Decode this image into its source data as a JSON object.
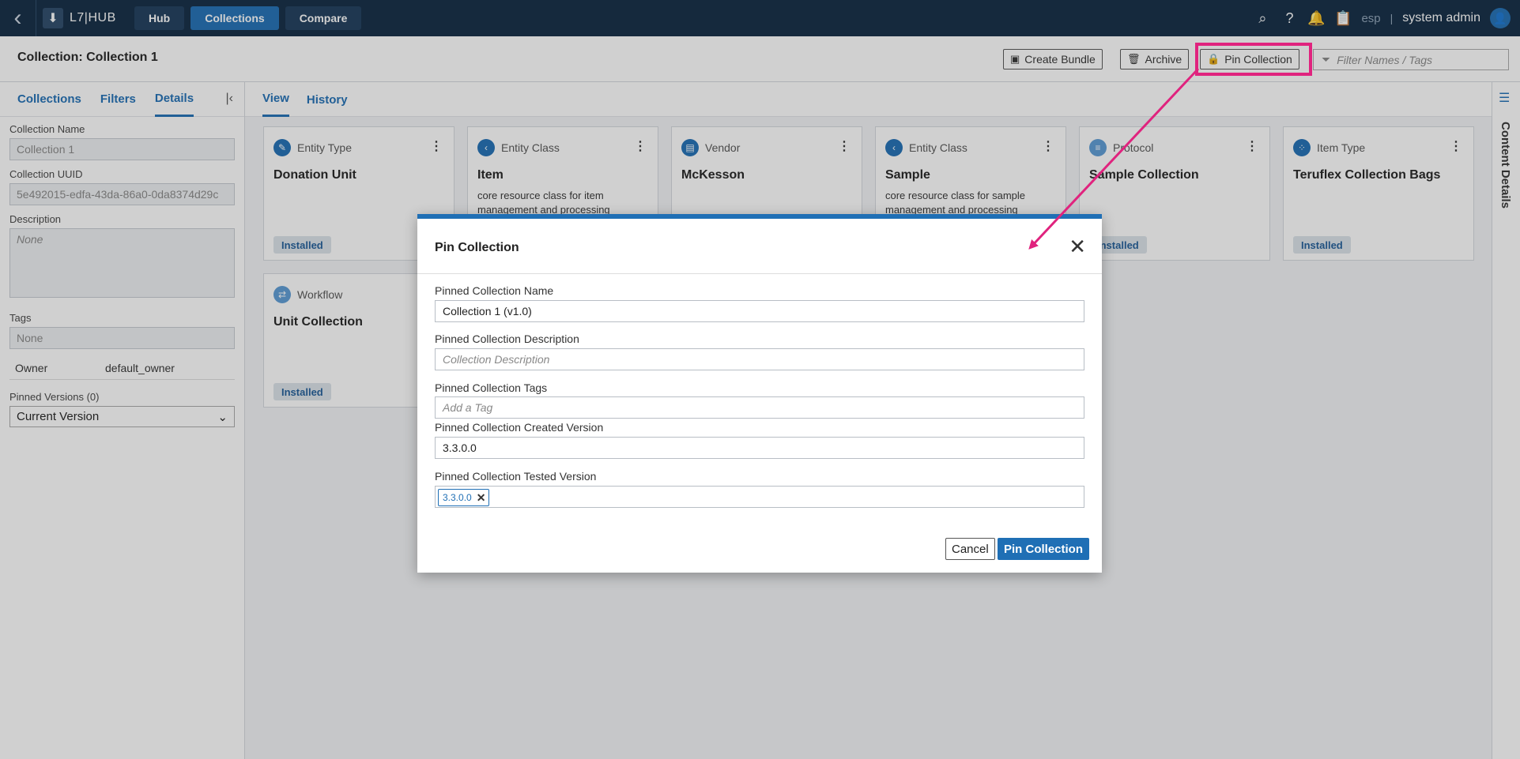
{
  "topbar": {
    "logo_text": "L7|HUB",
    "nav": [
      "Hub",
      "Collections",
      "Compare"
    ],
    "lang": "esp",
    "separator": "|",
    "user": "system admin"
  },
  "header": {
    "title": "Collection: Collection 1",
    "create_bundle": "Create Bundle",
    "archive": "Archive",
    "pin_collection": "Pin Collection",
    "filter_placeholder": "Filter Names / Tags"
  },
  "left": {
    "tabs": [
      "Collections",
      "Filters",
      "Details"
    ],
    "collection_name_label": "Collection Name",
    "collection_name": "Collection 1",
    "uuid_label": "Collection UUID",
    "uuid": "5e492015-edfa-43da-86a0-0da8374d29c",
    "description_label": "Description",
    "description": "None",
    "tags_label": "Tags",
    "tags": "None",
    "owner_label": "Owner",
    "owner": "default_owner",
    "pinned_versions_label": "Pinned Versions (0)",
    "pinned_version_selected": "Current Version"
  },
  "main": {
    "tabs": [
      "View",
      "History"
    ],
    "cards": [
      {
        "type": "Entity Type",
        "title": "Donation Unit",
        "desc": "",
        "badge": "Installed"
      },
      {
        "type": "Entity Class",
        "title": "Item",
        "desc": "core resource class for item management and processing",
        "badge": ""
      },
      {
        "type": "Vendor",
        "title": "McKesson",
        "desc": "",
        "badge": ""
      },
      {
        "type": "Entity Class",
        "title": "Sample",
        "desc": "core resource class for sample management and processing",
        "badge": ""
      },
      {
        "type": "Protocol",
        "title": "Sample Collection",
        "desc": "",
        "badge": "Installed"
      },
      {
        "type": "Item Type",
        "title": "Teruflex Collection Bags",
        "desc": "",
        "badge": "Installed"
      },
      {
        "type": "Workflow",
        "title": "Unit Collection",
        "desc": "",
        "badge": "Installed"
      }
    ]
  },
  "rail": {
    "label": "Content Details"
  },
  "modal": {
    "title": "Pin Collection",
    "name_label": "Pinned Collection Name",
    "name_value": "Collection 1 (v1.0)",
    "desc_label": "Pinned Collection Description",
    "desc_placeholder": "Collection Description",
    "tags_label": "Pinned Collection Tags",
    "tags_placeholder": "Add a Tag",
    "created_label": "Pinned Collection Created Version",
    "created_value": "3.3.0.0",
    "tested_label": "Pinned Collection Tested Version",
    "tested_chip": "3.3.0.0",
    "cancel": "Cancel",
    "submit": "Pin Collection"
  },
  "colors": {
    "accent": "#1f6fb5",
    "topbar": "#102a43",
    "annotation": "#e0237e"
  }
}
